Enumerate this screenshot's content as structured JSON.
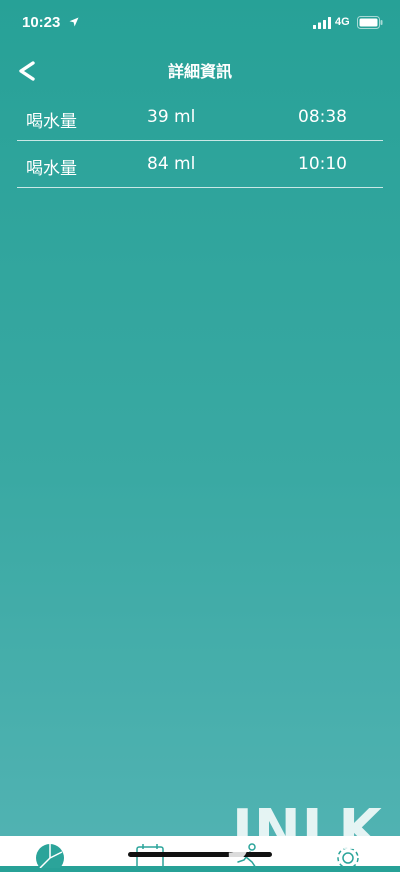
{
  "status_bar": {
    "time": "10:23",
    "network": "4G",
    "icons": [
      "location-arrow-icon",
      "signal-icon",
      "battery-icon"
    ]
  },
  "header": {
    "title": "詳細資訊",
    "back_icon": "chevron-left-icon"
  },
  "records": [
    {
      "label": "喝水量",
      "amount": "39 ml",
      "time": "08:38"
    },
    {
      "label": "喝水量",
      "amount": "84 ml",
      "time": "10:10"
    }
  ],
  "tab_bar": {
    "icons": [
      "pie-chart-icon",
      "calendar-icon",
      "run-icon",
      "gear-icon"
    ],
    "accent_color": "#2ba49a"
  },
  "watermark": "JNLK",
  "colors": {
    "background_top": "#27a197",
    "background_bottom": "#52b3b3",
    "text": "#ffffff"
  }
}
